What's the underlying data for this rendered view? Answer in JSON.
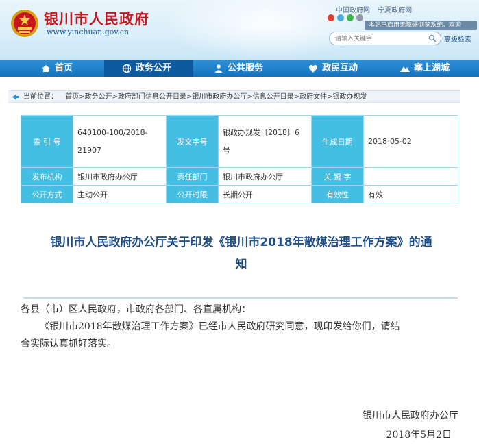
{
  "header": {
    "site_title": "银川市人民政府",
    "site_domain": "www.yinchuan.gov.cn",
    "top_links": [
      "中国政府网",
      "宁夏政府网"
    ],
    "access_notice": "本站已启用无障碍浏览系统。欢迎",
    "search_placeholder": "请输入关键字",
    "advanced_search": "高级检索"
  },
  "nav": {
    "items": [
      {
        "label": "首页",
        "icon": "home-icon"
      },
      {
        "label": "政务公开",
        "icon": "globe-icon"
      },
      {
        "label": "公共服务",
        "icon": "person-icon"
      },
      {
        "label": "政民互动",
        "icon": "heart-icon"
      },
      {
        "label": "塞上湖城",
        "icon": "mountain-icon"
      }
    ],
    "active": "政务公开"
  },
  "breadcrumb": {
    "prefix": "当前位置：",
    "path": "首页>政务公开>政府部门信息公开目录>银川市政府办公厅>信息公开目录>政府文件>银政办规发"
  },
  "info_table": {
    "index_label": "索 引 号",
    "index_value_line1": "640100-100/2018-",
    "index_value_line2": "21907",
    "doc_no_label": "发文字号",
    "doc_no_value_line1": "银政办规发〔2018〕6",
    "doc_no_value_line2": "号",
    "created_label": "生成日期",
    "created_value": "2018-05-02",
    "publisher_label": "发布机构",
    "publisher_value": "银川市政府办公厅",
    "dept_label": "责任部门",
    "dept_value": "银川市政府办公厅",
    "keyword_label": "关 键 字",
    "keyword_value": "",
    "disclosure_label": "公开方式",
    "disclosure_value": "主动公开",
    "period_label": "公开时限",
    "period_value": "长期公开",
    "validity_label": "有效性",
    "validity_value": "有效"
  },
  "document": {
    "title_line1": "银川市人民政府办公厅关于印发《银川市2018年散煤治理工作方案》的通",
    "title_line2": "知",
    "salutation": "各县（市）区人民政府，市政府各部门、各直属机构：",
    "paragraph_line1": "《银川市2018年散煤治理工作方案》已经市人民政府研究同意，现印发给你们，请结",
    "paragraph_line2": "合实际认真抓好落实。",
    "signer": "银川市人民政府办公厅",
    "date": "2018年5月2日"
  },
  "colors": {
    "brand_red": "#c8161d",
    "nav_blue": "#1572be",
    "label_cyan": "#44bfe3",
    "title_blue": "#1f4f8a"
  }
}
